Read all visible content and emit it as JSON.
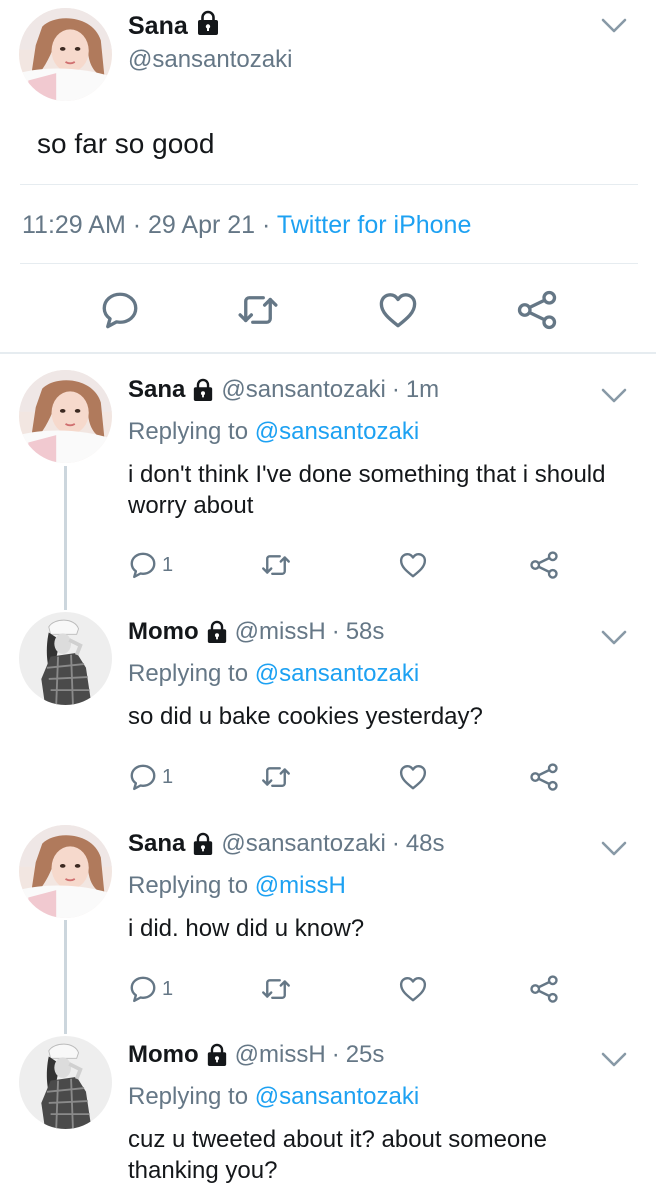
{
  "main_tweet": {
    "name": "Sana",
    "handle": "@sansantozaki",
    "text": "so far so good",
    "time": "11:29 AM",
    "date": "29 Apr 21",
    "source": "Twitter for iPhone",
    "icons": [
      "reply-icon",
      "retweet-icon",
      "like-icon",
      "share-icon"
    ]
  },
  "replies": [
    {
      "name": "Sana",
      "handle": "@sansantozaki",
      "time": "1m",
      "replying_prefix": "Replying to",
      "replying_to": "@sansantozaki",
      "text": "i don't think I've done something that i should worry about",
      "reply_count": "1"
    },
    {
      "name": "Momo",
      "handle": "@missH",
      "time": "58s",
      "replying_prefix": "Replying to",
      "replying_to": "@sansantozaki",
      "text": "so did u bake cookies yesterday?",
      "reply_count": "1"
    },
    {
      "name": "Sana",
      "handle": "@sansantozaki",
      "time": "48s",
      "replying_prefix": "Replying to",
      "replying_to": "@missH",
      "text": "i did. how did u know?",
      "reply_count": "1"
    },
    {
      "name": "Momo",
      "handle": "@missH",
      "time": "25s",
      "replying_prefix": "Replying to",
      "replying_to": "@sansantozaki",
      "text": "cuz u tweeted about it? about someone thanking you?"
    }
  ],
  "separator": "·",
  "colors": {
    "accent": "#1da1f2",
    "secondary_text": "#657786",
    "icon": "#657786",
    "divider": "#e6ecf0"
  }
}
